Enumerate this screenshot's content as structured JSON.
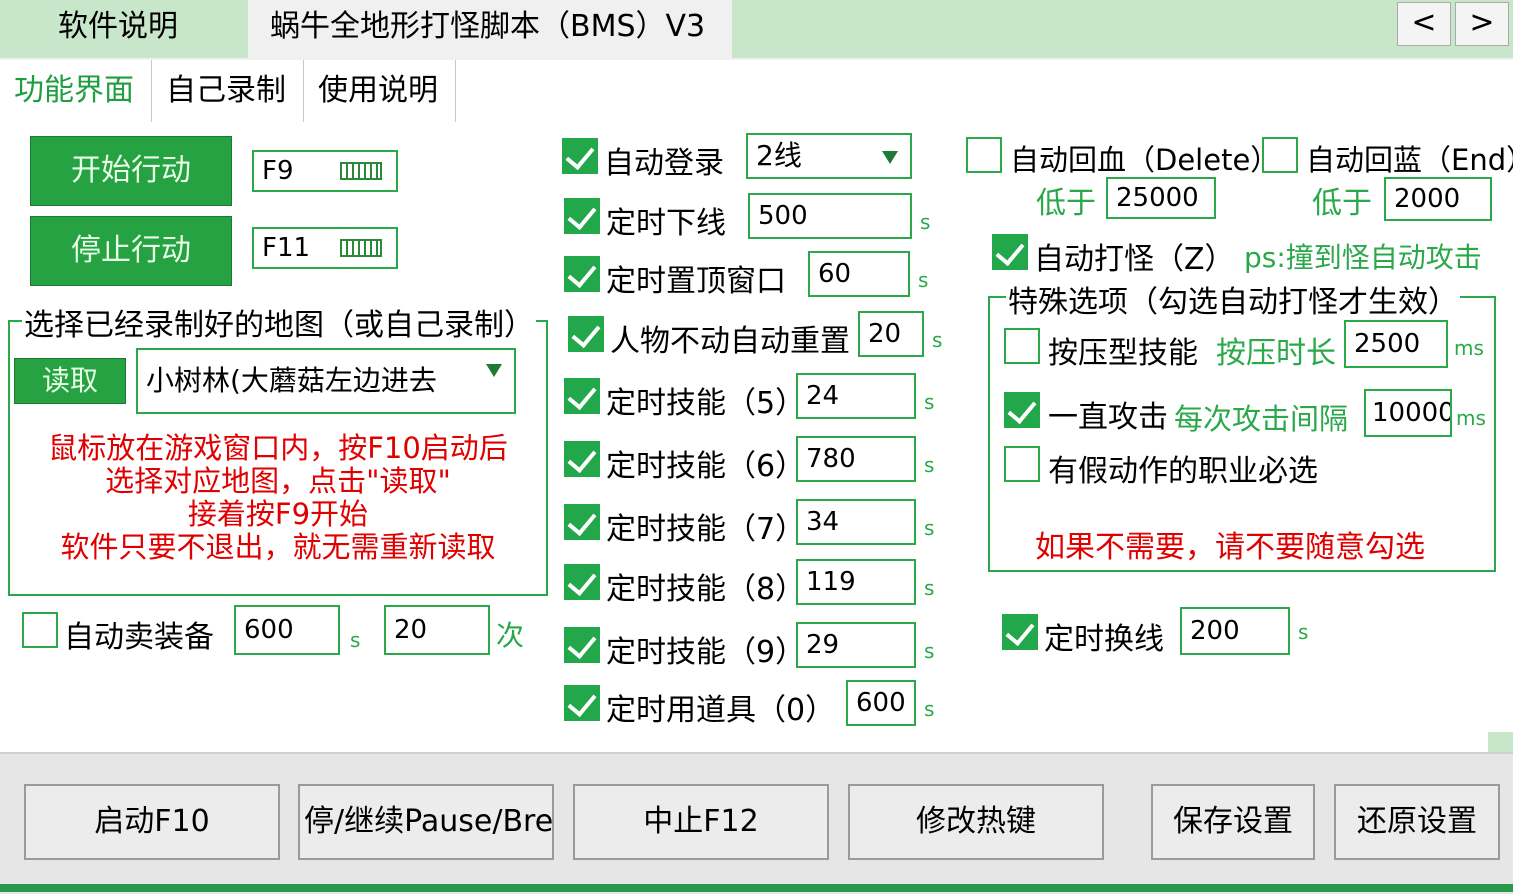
{
  "tabs": {
    "top": [
      "软件说明",
      "蜗牛全地形打怪脚本（BMS）V3"
    ],
    "nav_prev": "<",
    "nav_next": ">",
    "sub": [
      "功能界面",
      "自己录制",
      "使用说明"
    ]
  },
  "left": {
    "start_btn": "开始行动",
    "stop_btn": "停止行动",
    "start_hotkey": "F9",
    "stop_hotkey": "F11",
    "map_group_title": "选择已经录制好的地图（或自己录制）",
    "read_btn": "读取",
    "map_select_value": "小树林(大蘑菇左边进去",
    "instructions": [
      "鼠标放在游戏窗口内，按F10启动后",
      "选择对应地图，点击\"读取\"",
      "接着按F9开始",
      "软件只要不退出，就无需重新读取"
    ],
    "auto_sell": {
      "label": "自动卖装备",
      "checked": false,
      "value1": "600",
      "unit1": "s",
      "value2": "20",
      "unit2": "次"
    }
  },
  "middle": {
    "auto_login": {
      "label": "自动登录",
      "checked": true,
      "value": "2线"
    },
    "rows": [
      {
        "label": "定时下线",
        "checked": true,
        "value": "500",
        "unit": "s"
      },
      {
        "label": "定时置顶窗口",
        "checked": true,
        "value": "60",
        "unit": "s"
      },
      {
        "label": "人物不动自动重置",
        "checked": true,
        "value": "20",
        "unit": "s"
      },
      {
        "label": "定时技能（5）",
        "checked": true,
        "value": "24",
        "unit": "s"
      },
      {
        "label": "定时技能（6）",
        "checked": true,
        "value": "780",
        "unit": "s"
      },
      {
        "label": "定时技能（7）",
        "checked": true,
        "value": "34",
        "unit": "s"
      },
      {
        "label": "定时技能（8）",
        "checked": true,
        "value": "119",
        "unit": "s"
      },
      {
        "label": "定时技能（9）",
        "checked": true,
        "value": "29",
        "unit": "s"
      },
      {
        "label": "定时用道具（0）",
        "checked": true,
        "value": "600",
        "unit": "s"
      }
    ]
  },
  "right": {
    "auto_hp": {
      "label": "自动回血（Delete）",
      "checked": false,
      "below_label": "低于",
      "value": "25000"
    },
    "auto_mp": {
      "label": "自动回蓝（End）",
      "checked": false,
      "below_label": "低于",
      "value": "2000"
    },
    "auto_fight": {
      "label": "自动打怪（Z）",
      "checked": true,
      "note": "ps:撞到怪自动攻击"
    },
    "special_group_title": "特殊选项（勾选自动打怪才生效）",
    "press_skill": {
      "label": "按压型技能",
      "checked": false,
      "sub_label": "按压时长",
      "value": "2500",
      "unit": "ms"
    },
    "always_attack": {
      "label": "一直攻击",
      "checked": true,
      "sub_label": "每次攻击间隔",
      "value": "10000",
      "unit": "ms"
    },
    "fake_action": {
      "label": "有假动作的职业必选",
      "checked": false
    },
    "warning": "如果不需要，请不要随意勾选",
    "switch_line": {
      "label": "定时换线",
      "checked": true,
      "value": "200",
      "unit": "s"
    }
  },
  "bottom": [
    "启动F10",
    "停/继续Pause/Break",
    "中止F12",
    "修改热键",
    "保存设置",
    "还原设置"
  ],
  "colors": {
    "accent": "#27a243",
    "tab_bg": "#c8e6c9",
    "warning": "#e00000"
  }
}
